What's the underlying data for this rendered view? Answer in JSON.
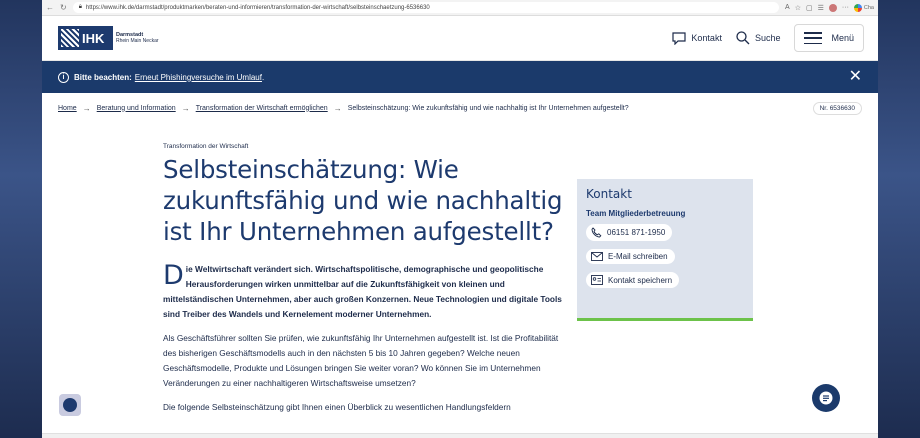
{
  "browser": {
    "url": "https://www.ihk.de/darmstadt/produktmarken/beraten-und-informieren/transformation-der-wirtschaft/selbsteinschaetzung-6536630",
    "chat_label": "Cha"
  },
  "header": {
    "logo_text": "IHK",
    "logo_sub1": "Darmstadt",
    "logo_sub2": "Rhein Main Neckar",
    "contact_label": "Kontakt",
    "search_label": "Suche",
    "menu_label": "Menü"
  },
  "notice": {
    "prefix": "Bitte beachten:",
    "link": "Erneut Phishingversuche im Umlauf",
    "suffix": "."
  },
  "breadcrumb": {
    "items": [
      "Home",
      "Beratung und Information",
      "Transformation der Wirtschaft ermöglichen"
    ],
    "current": "Selbsteinschätzung: Wie zukunftsfähig und wie nachhaltig ist Ihr Unternehmen aufgestellt?",
    "nr": "Nr. 6536630"
  },
  "main": {
    "kicker": "Transformation der Wirtschaft",
    "title": "Selbsteinschätzung: Wie zukunftsfähig und wie nachhaltig ist Ihr Unternehmen aufgestellt?",
    "lead_initial": "D",
    "lead_rest": "ie Weltwirtschaft verändert sich. Wirtschaftspolitische, demographische und geopolitische Herausforderungen wirken unmittelbar auf die Zukunftsfähigkeit von kleinen und mittelständischen Unternehmen, aber auch großen Konzernen. Neue Technologien und digitale Tools sind Treiber des Wandels und Kernelement moderner Unternehmen.",
    "para1": "Als Geschäftsführer sollten Sie prüfen, wie zukunftsfähig Ihr Unternehmen aufgestellt ist. Ist die Profitabilität des bisherigen Geschäftsmodells auch in den nächsten 5 bis 10 Jahren gegeben? Welche neuen Geschäftsmodelle, Produkte und Lösungen bringen Sie weiter voran? Wo können Sie im Unternehmen Veränderungen zu einer nachhaltigeren Wirtschaftsweise umsetzen?",
    "para2": "Die folgende Selbsteinschätzung gibt Ihnen einen Überblick zu wesentlichen Handlungsfeldern"
  },
  "contact": {
    "heading": "Kontakt",
    "team": "Team Mitgliederbetreuung",
    "phone": "06151 871-1950",
    "email": "E-Mail schreiben",
    "save": "Kontakt speichern"
  },
  "colors": {
    "brand": "#1d3a6e",
    "notice_bg": "#1b3a6b",
    "accent_green": "#6cc24a",
    "card_bg": "#dde3ed"
  }
}
